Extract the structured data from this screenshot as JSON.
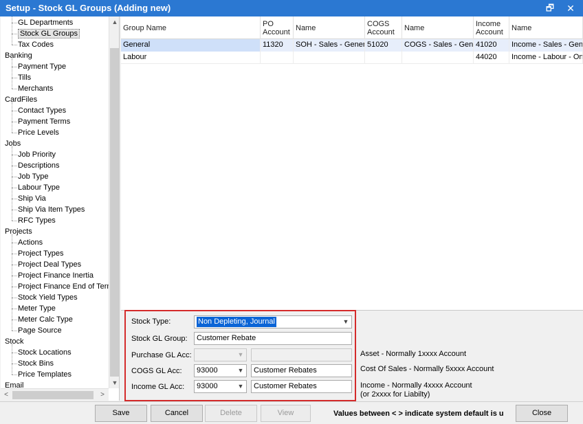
{
  "window": {
    "title": "Setup - Stock GL Groups (Adding new)",
    "restore_glyph": "🗗",
    "close_glyph": "✕"
  },
  "tree": {
    "nodes": [
      {
        "label": "GL Departments",
        "level": 1
      },
      {
        "label": "Stock GL Groups",
        "level": 1,
        "selected": true
      },
      {
        "label": "Tax Codes",
        "level": 1
      },
      {
        "label": "Banking",
        "level": 0
      },
      {
        "label": "Payment Type",
        "level": 1
      },
      {
        "label": "Tills",
        "level": 1
      },
      {
        "label": "Merchants",
        "level": 1
      },
      {
        "label": "CardFiles",
        "level": 0
      },
      {
        "label": "Contact Types",
        "level": 1
      },
      {
        "label": "Payment Terms",
        "level": 1
      },
      {
        "label": "Price Levels",
        "level": 1
      },
      {
        "label": "Jobs",
        "level": 0
      },
      {
        "label": "Job Priority",
        "level": 1
      },
      {
        "label": "Descriptions",
        "level": 1
      },
      {
        "label": "Job Type",
        "level": 1
      },
      {
        "label": "Labour Type",
        "level": 1
      },
      {
        "label": "Ship Via",
        "level": 1
      },
      {
        "label": "Ship Via Item Types",
        "level": 1
      },
      {
        "label": "RFC Types",
        "level": 1
      },
      {
        "label": "Projects",
        "level": 0
      },
      {
        "label": "Actions",
        "level": 1
      },
      {
        "label": "Project Types",
        "level": 1
      },
      {
        "label": "Project Deal Types",
        "level": 1
      },
      {
        "label": "Project Finance Inertia",
        "level": 1
      },
      {
        "label": "Project Finance End of Term",
        "level": 1
      },
      {
        "label": "Stock Yield Types",
        "level": 1
      },
      {
        "label": "Meter Type",
        "level": 1
      },
      {
        "label": "Meter Calc Type",
        "level": 1
      },
      {
        "label": "Page Source",
        "level": 1
      },
      {
        "label": "Stock",
        "level": 0
      },
      {
        "label": "Stock Locations",
        "level": 1
      },
      {
        "label": "Stock Bins",
        "level": 1
      },
      {
        "label": "Price Templates",
        "level": 1
      },
      {
        "label": "Email",
        "level": 0
      }
    ],
    "scroll_up": "▲",
    "scroll_down": "▼",
    "scroll_left": "<",
    "scroll_right": ">"
  },
  "grid": {
    "columns": [
      "Group Name",
      "PO Account",
      "Name",
      "COGS Account",
      "Name",
      "Income Account",
      "Name"
    ],
    "rows": [
      [
        "General",
        "11320",
        "SOH - Sales - General",
        "51020",
        "COGS - Sales - General",
        "41020",
        "Income - Sales - General"
      ],
      [
        "Labour",
        "",
        "",
        "",
        "",
        "44020",
        "Income - Labour - On Site"
      ]
    ]
  },
  "form": {
    "stock_type_label": "Stock Type:",
    "stock_type_value": "Non Depleting, Journal",
    "stock_gl_group_label": "Stock GL Group:",
    "stock_gl_group_value": "Customer Rebate",
    "purchase_gl_label": "Purchase GL Acc:",
    "purchase_gl_code": "",
    "purchase_gl_name": "",
    "cogs_gl_label": "COGS GL Acc:",
    "cogs_gl_code": "93000",
    "cogs_gl_name": "Customer Rebates",
    "income_gl_label": "Income GL Acc:",
    "income_gl_code": "93000",
    "income_gl_name": "Customer Rebates",
    "dropdown_glyph": "▼"
  },
  "hints": {
    "asset": "Asset - Normally 1xxxx Account",
    "cogs": "Cost Of Sales - Normally 5xxxx Account",
    "income_line1": "Income - Normally 4xxxx Account",
    "income_line2": "(or 2xxxx for Liabilty)"
  },
  "buttons": {
    "save": "Save",
    "cancel": "Cancel",
    "delete": "Delete",
    "view": "View",
    "close": "Close"
  },
  "notice": "Values between < > indicate system default is u",
  "colors": {
    "titlebar": "#2b78d2",
    "highlight_border": "#d42a2a",
    "selection": "#0a64d6"
  }
}
